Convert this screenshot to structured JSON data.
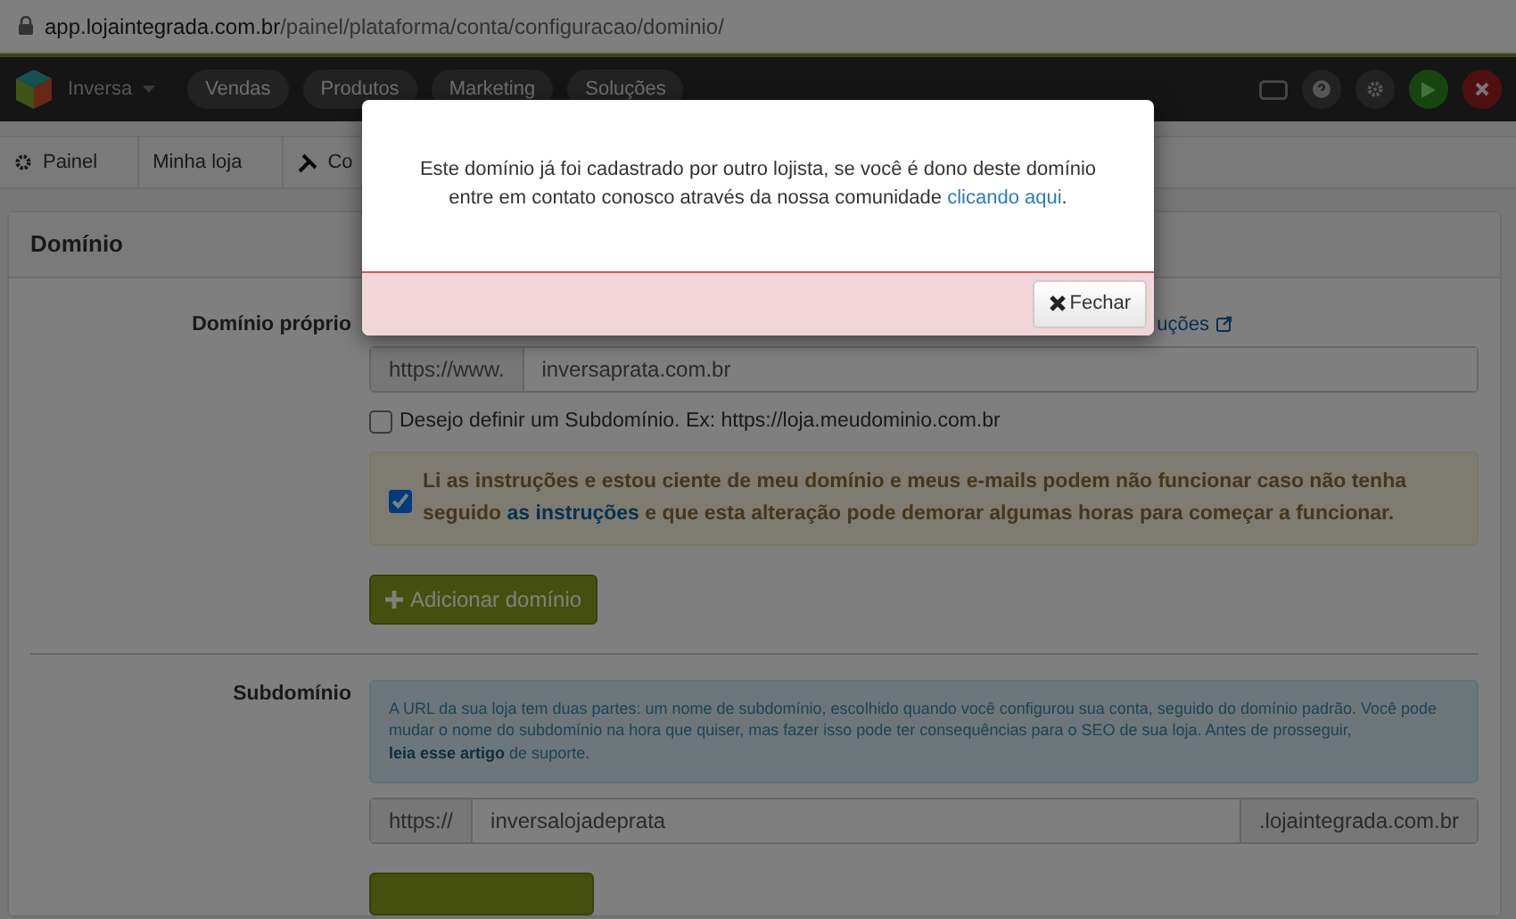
{
  "address_bar": {
    "url_domain": "app.lojaintegrada.com.br",
    "url_path": "/painel/plataforma/conta/configuracao/dominio/"
  },
  "navbar": {
    "store_name": "Inversa",
    "menu": [
      "Vendas",
      "Produtos",
      "Marketing",
      "Soluções"
    ]
  },
  "breadcrumb": [
    "Painel",
    "Minha loja",
    "Co"
  ],
  "panel": {
    "title": "Domínio",
    "own_domain": {
      "label": "Domínio próprio",
      "help_link": "uções",
      "prefix": "https://www.",
      "value": "inversaprata.com.br",
      "subdomain_option": {
        "label": "Desejo definir um Subdomínio. Ex: https://loja.meudominio.com.br",
        "checked": false
      },
      "acknowledge": {
        "text_before": "Li as instruções e estou ciente de meu domínio e meus e-mails podem não funcionar caso não tenha seguido ",
        "link": "as instruções",
        "text_after": " e que esta alteração pode demorar algumas horas para começar a funcionar.",
        "checked": true
      },
      "add_button": "Adicionar domínio"
    },
    "subdomain": {
      "label": "Subdomínio",
      "info_before": "A URL da sua loja tem duas partes: um nome de subdomínio, escolhido quando você configurou sua conta, seguido do domínio padrão. Você pode mudar o nome do subdomínio na hora que quiser, mas fazer isso pode ter consequências para o SEO de sua loja. Antes de prosseguir, ",
      "info_link": "leia esse artigo",
      "info_after": " de suporte.",
      "prefix": "https://",
      "value": "inversalojadeprata",
      "suffix": ".lojaintegrada.com.br"
    }
  },
  "modal": {
    "message": "Este domínio já foi cadastrado por outro lojista, se você é dono deste domínio entre em contato conosco através da nossa comunidade ",
    "link": "clicando aqui",
    "message_end": ".",
    "close_button": "Fechar"
  }
}
